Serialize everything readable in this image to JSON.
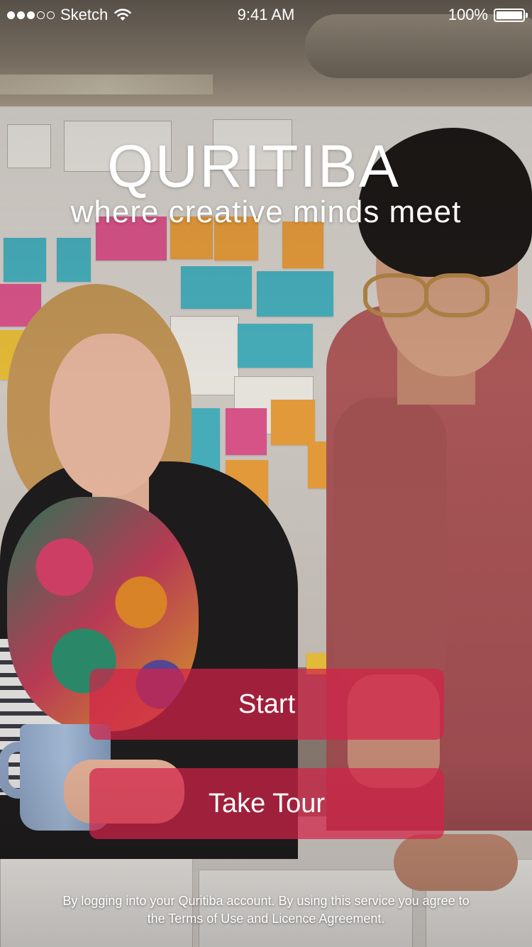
{
  "status_bar": {
    "carrier": "Sketch",
    "time": "9:41 AM",
    "battery": "100%",
    "signal_icon": "signal-dots-icon",
    "wifi_icon": "wifi-icon",
    "battery_icon": "battery-icon"
  },
  "hero": {
    "title": "QURITIBA",
    "tagline": "where creative minds meet"
  },
  "actions": {
    "start_label": "Start",
    "tour_label": "Take Tour"
  },
  "footer": {
    "legal_line_1": "By logging into your Quritiba account. By using this service you agree to",
    "legal_line_2": "the Terms of Use and Licence Agreement."
  },
  "colors": {
    "button_bg": "#d22248",
    "text": "#ffffff"
  }
}
